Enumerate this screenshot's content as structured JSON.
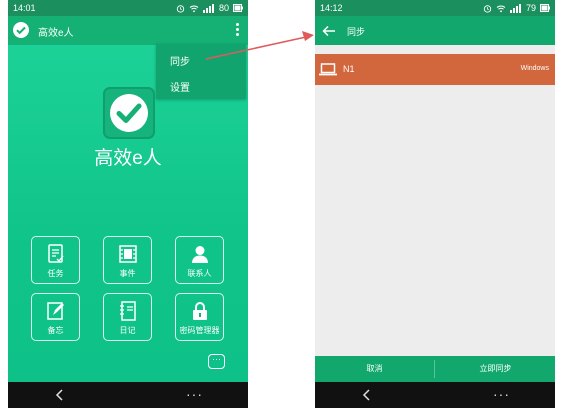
{
  "left_phone": {
    "status_bar": {
      "time": "14:01",
      "battery": "80"
    },
    "app_bar": {
      "title": "高效e人"
    },
    "dropdown_menu": {
      "items": [
        {
          "label": "同步"
        },
        {
          "label": "设置"
        }
      ]
    },
    "logo_title": "高效e人",
    "tiles": [
      {
        "label": "任务",
        "icon": "task-icon"
      },
      {
        "label": "事件",
        "icon": "event-icon"
      },
      {
        "label": "联系人",
        "icon": "contact-icon"
      },
      {
        "label": "备忘",
        "icon": "memo-icon"
      },
      {
        "label": "日记",
        "icon": "diary-icon"
      },
      {
        "label": "密码管理器",
        "icon": "lock-icon"
      }
    ],
    "more_label": "···",
    "navbar": {
      "more": "···"
    }
  },
  "right_phone": {
    "status_bar": {
      "time": "14:12",
      "battery": "79"
    },
    "app_bar": {
      "title": "同步"
    },
    "device": {
      "name": "N1",
      "os": "Windows"
    },
    "buttons": {
      "cancel": "取消",
      "sync_now": "立即同步"
    },
    "navbar": {
      "more": "···"
    }
  },
  "colors": {
    "primary_green": "#14b074",
    "status_green": "#1b8f5e",
    "device_row": "#d2663c",
    "arrow": "#e05a5a"
  }
}
